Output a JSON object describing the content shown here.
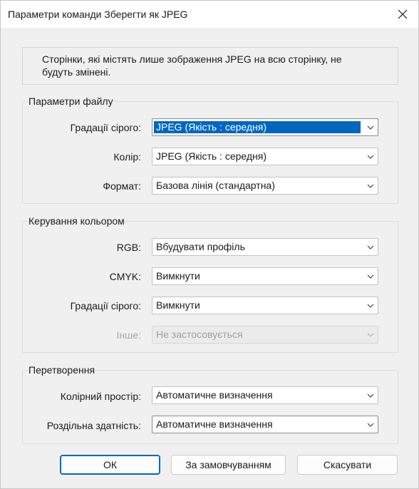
{
  "window": {
    "title": "Параметри команди Зберегти як JPEG"
  },
  "info": {
    "line1": "Сторінки, які містять лише зображення JPEG на всю сторінку, не",
    "line2": "будуть змінені."
  },
  "file_params": {
    "title": "Параметри файлу",
    "rows": [
      {
        "label": "Градації сірого:",
        "value": "JPEG (Якість : середня)"
      },
      {
        "label": "Колір:",
        "value": "JPEG (Якість : середня)"
      },
      {
        "label": "Формат:",
        "value": "Базова лінія (стандартна)"
      }
    ]
  },
  "color_mgmt": {
    "title": "Керування кольором",
    "rows": [
      {
        "label": "RGB:",
        "value": "Вбудувати профіль"
      },
      {
        "label": "CMYK:",
        "value": "Вимкнути"
      },
      {
        "label": "Градації сірого:",
        "value": "Вимкнути"
      },
      {
        "label": "Інше:",
        "value": "Не застосовується"
      }
    ]
  },
  "conversion": {
    "title": "Перетворення",
    "rows": [
      {
        "label": "Колірний простір:",
        "value": "Автоматичне визначення"
      },
      {
        "label": "Роздільна здатність:",
        "value": "Автоматичне визначення"
      }
    ]
  },
  "buttons": {
    "ok": "ОК",
    "defaults": "За замовчуванням",
    "cancel": "Скасувати"
  },
  "colors": {
    "accent": "#0067c0",
    "background": "#f0f0f0"
  },
  "icons": {
    "close": "close-icon",
    "dropdown": "chevron-down-icon"
  }
}
